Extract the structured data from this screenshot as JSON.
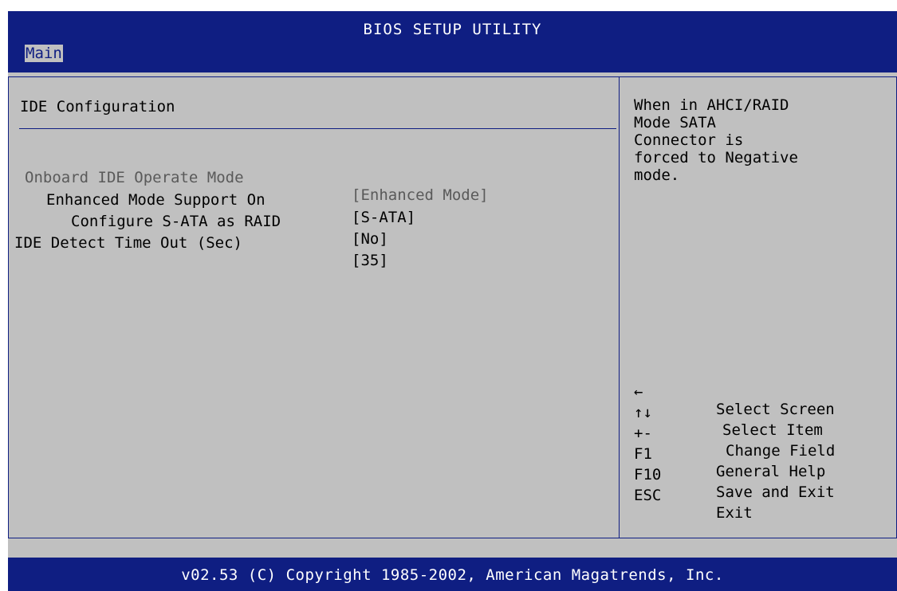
{
  "header": {
    "title": "BIOS SETUP UTILITY",
    "tabs": [
      {
        "label": "Main"
      }
    ]
  },
  "section": {
    "title": "IDE Configuration",
    "items": [
      {
        "label": "Onboard IDE Operate Mode",
        "value": "[Enhanced Mode]"
      },
      {
        "label": "Enhanced Mode Support On",
        "value": "[S-ATA]"
      },
      {
        "label": "Configure S-ATA as RAID",
        "value": "[No]"
      },
      {
        "label": "IDE Detect Time Out (Sec)",
        "value": "[35]"
      }
    ]
  },
  "help": {
    "text": "When in AHCI/RAID\nMode SATA\nConnector is\nforced to Negative\nmode."
  },
  "keys": [
    {
      "key": "←",
      "desc": "Select Screen"
    },
    {
      "key": "↑↓",
      "desc": "Select Item"
    },
    {
      "key": "+-",
      "desc": "Change Field"
    },
    {
      "key": "F1",
      "desc": "General Help"
    },
    {
      "key": "F10",
      "desc": "Save and Exit"
    },
    {
      "key": "ESC",
      "desc": "Exit"
    }
  ],
  "footer": {
    "copyright": "v02.53 (C) Copyright 1985-2002, American Magatrends, Inc."
  },
  "colors": {
    "bios_blue": "#0f1e82",
    "panel_gray": "#c0c0c0"
  }
}
